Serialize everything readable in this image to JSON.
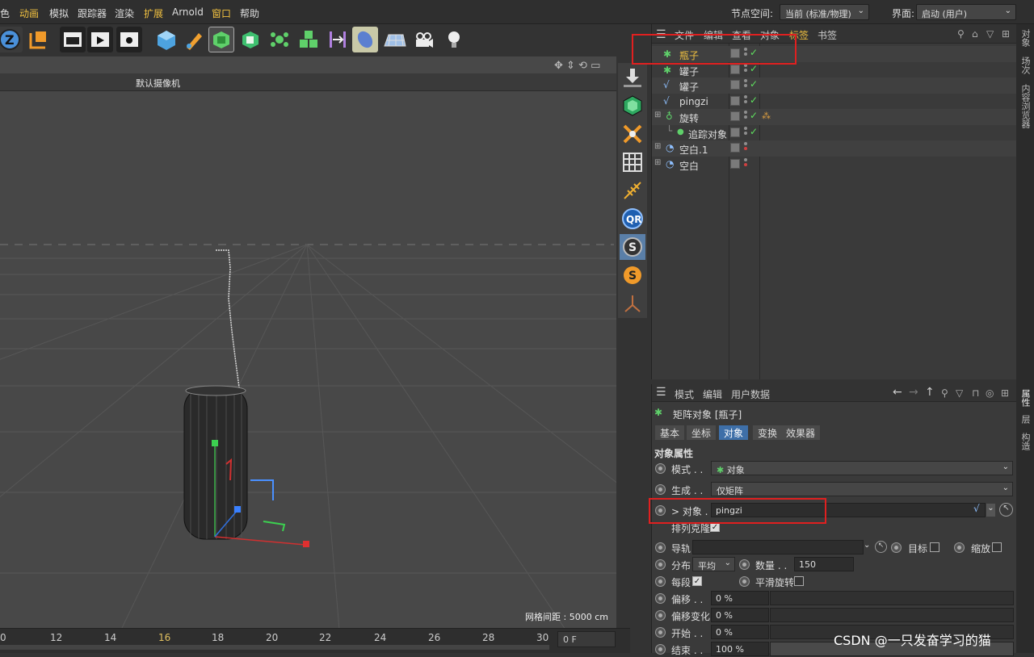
{
  "menubar": {
    "items": [
      "色",
      "动画",
      "模拟",
      "跟踪器",
      "渲染",
      "扩展",
      "Arnold",
      "窗口",
      "帮助"
    ],
    "node_space_label": "节点空间:",
    "node_space_value": "当前 (标准/物理)",
    "layout_label": "界面:",
    "layout_value": "启动 (用户)"
  },
  "viewport": {
    "title": "默认摄像机",
    "grid_spacing": "网格间距 : 5000 cm"
  },
  "timeline": {
    "ticks": [
      "0",
      "12",
      "14",
      "16",
      "18",
      "20",
      "22",
      "24",
      "26",
      "28",
      "30"
    ],
    "frame": "0 F"
  },
  "object_manager": {
    "menu": [
      "文件",
      "编辑",
      "查看",
      "对象",
      "标签",
      "书签"
    ],
    "objects": [
      {
        "name": "瓶子",
        "highlight": true
      },
      {
        "name": "罐子"
      },
      {
        "name": "罐子"
      },
      {
        "name": "pingzi"
      },
      {
        "name": "旋转"
      },
      {
        "name": "追踪对象"
      },
      {
        "name": "空白.1"
      },
      {
        "name": "空白"
      }
    ]
  },
  "attributes": {
    "menu": [
      "模式",
      "编辑",
      "用户数据"
    ],
    "object_title": "矩阵对象 [瓶子]",
    "tabs": [
      "基本",
      "坐标",
      "对象",
      "变换",
      "效果器"
    ],
    "active_tab": "对象",
    "section": "对象属性",
    "props": {
      "mode_label": "模式 . .",
      "mode_value": "对象",
      "generate_label": "生成 . .",
      "generate_value": "仅矩阵",
      "object_label": "> 对象 .",
      "object_value": "pingzi",
      "arrange_clones_label": "排列克隆",
      "rail_label": "导轨",
      "target_label": "目标",
      "scale_label": "缩放",
      "distribution_label": "分布",
      "distribution_value": "平均",
      "count_label": "数量 . .",
      "count_value": "150",
      "per_segment_label": "每段",
      "smooth_rotation_label": "平滑旋转",
      "offset_label": "偏移 . .",
      "offset_value": "0 %",
      "offset_var_label": "偏移变化",
      "offset_var_value": "0 %",
      "start_label": "开始 . .",
      "start_value": "0 %",
      "end_label": "结束 . .",
      "end_value": "100 %"
    }
  },
  "right_tabs": [
    "对象",
    "场次",
    "内容浏览器",
    "属性",
    "层",
    "构造"
  ],
  "watermark": "CSDN @一只发奋学习的猫"
}
